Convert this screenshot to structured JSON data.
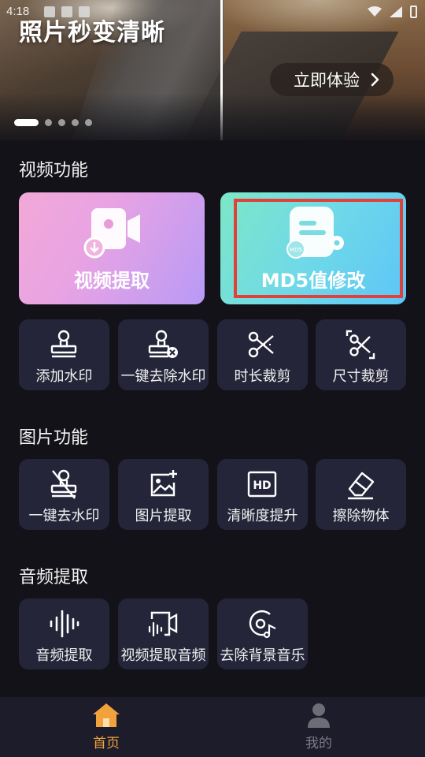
{
  "status_bar": {
    "time": "4:18"
  },
  "banner": {
    "title": "照片秒变清晰",
    "try_button": "立即体验",
    "slide_count": 5,
    "active_slide": 1
  },
  "sections": {
    "video": {
      "title": "视频功能",
      "big_cards": [
        {
          "label": "视频提取",
          "icon": "video-extract-icon"
        },
        {
          "label": "MD5值修改",
          "icon": "md5-settings-icon"
        }
      ],
      "tiles": [
        {
          "label": "添加水印",
          "icon": "stamp-icon"
        },
        {
          "label": "一键去除水印",
          "icon": "stamp-remove-icon"
        },
        {
          "label": "时长裁剪",
          "icon": "scissors-icon"
        },
        {
          "label": "尺寸裁剪",
          "icon": "crop-scissors-icon"
        }
      ]
    },
    "image": {
      "title": "图片功能",
      "tiles": [
        {
          "label": "一键去水印",
          "icon": "stamp-strike-icon"
        },
        {
          "label": "图片提取",
          "icon": "image-add-icon"
        },
        {
          "label": "清晰度提升",
          "icon": "hd-icon"
        },
        {
          "label": "擦除物体",
          "icon": "eraser-icon"
        }
      ]
    },
    "audio": {
      "title": "音频提取",
      "tiles": [
        {
          "label": "音频提取",
          "icon": "waveform-icon"
        },
        {
          "label": "视频提取音频",
          "icon": "video-audio-icon"
        },
        {
          "label": "去除背景音乐",
          "icon": "disc-music-icon"
        }
      ]
    }
  },
  "bottom_nav": {
    "home": {
      "label": "首页",
      "active": true
    },
    "mine": {
      "label": "我的",
      "active": false
    }
  },
  "colors": {
    "background": "#121218",
    "tile": "#25253a",
    "accent": "#f2a23d",
    "highlight": "#e0413b"
  }
}
